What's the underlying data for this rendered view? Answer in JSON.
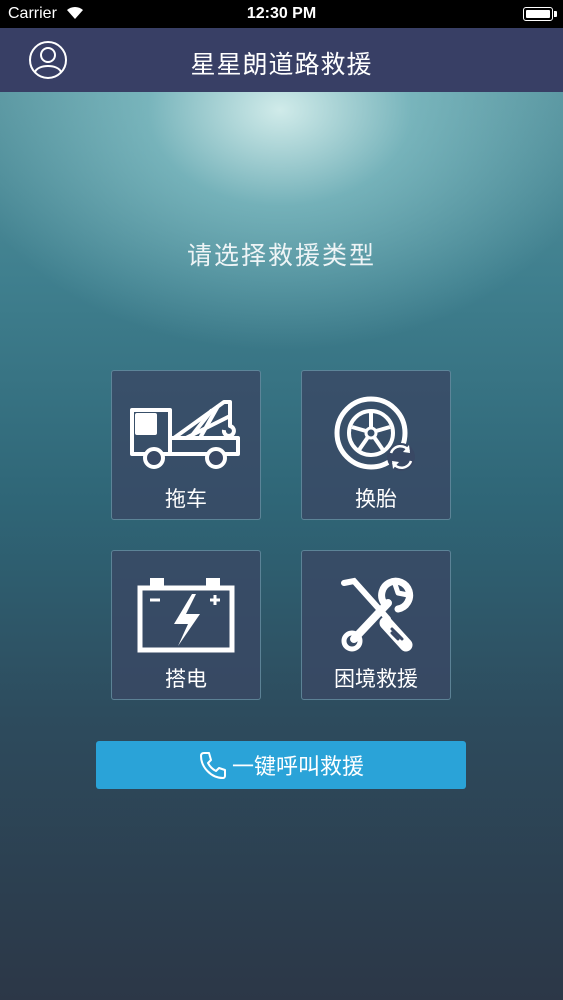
{
  "status_bar": {
    "carrier": "Carrier",
    "time": "12:30 PM",
    "battery_level": 1.0
  },
  "navbar": {
    "title": "星星朗道路救援",
    "profile_icon": "user-circle-icon"
  },
  "main": {
    "prompt": "请选择救援类型",
    "options": [
      {
        "label": "拖车",
        "icon": "tow-truck-icon"
      },
      {
        "label": "换胎",
        "icon": "tire-change-icon"
      },
      {
        "label": "搭电",
        "icon": "battery-icon"
      },
      {
        "label": "困境救援",
        "icon": "tools-icon"
      }
    ],
    "call_button": {
      "label": "一键呼叫救援",
      "icon": "phone-icon"
    }
  },
  "colors": {
    "navbar": "#383f65",
    "tile": "#394864",
    "call_button": "#2aa3d8"
  }
}
